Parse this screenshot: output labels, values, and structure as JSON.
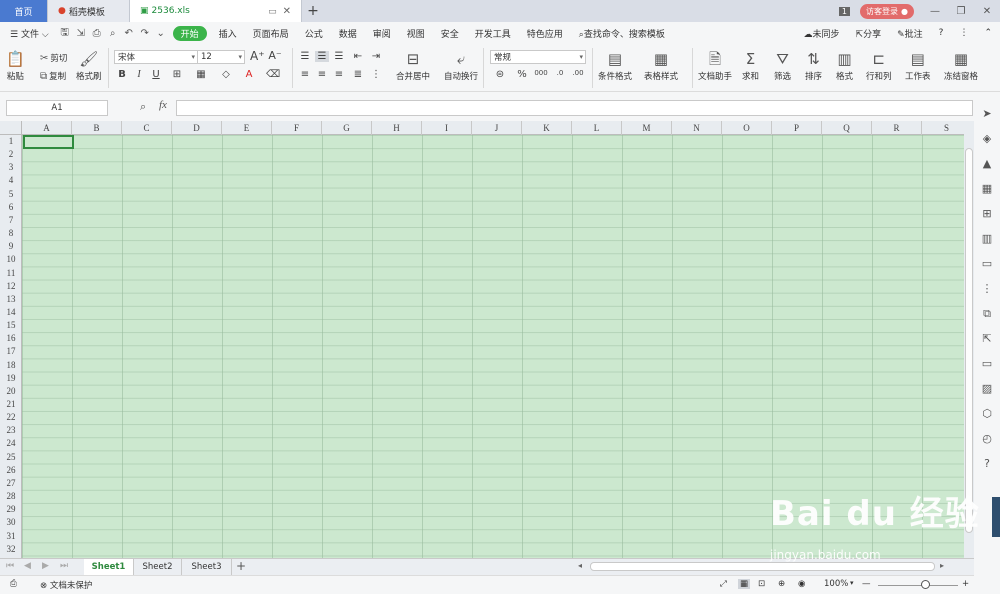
{
  "tabs": {
    "home": "首页",
    "template": "稻壳模板",
    "file": "2536.xls",
    "close": "✕",
    "new_tab": "+"
  },
  "window": {
    "badge": "1",
    "login": "访客登录",
    "minimize": "—",
    "restore": "❐",
    "close": "✕"
  },
  "menu": {
    "file": "文件",
    "items": [
      "开始",
      "插入",
      "页面布局",
      "公式",
      "数据",
      "审阅",
      "视图",
      "安全",
      "开发工具",
      "特色应用"
    ],
    "search": "查找命令、搜索模板",
    "sync": "未同步",
    "share": "分享",
    "comment": "批注",
    "help": "?"
  },
  "ribbon": {
    "paste": "粘贴",
    "cut": "剪切",
    "copy": "复制",
    "format_painter": "格式刷",
    "font_name": "宋体",
    "font_size": "12",
    "bold": "B",
    "italic": "I",
    "underline": "U",
    "font_color_letter": "A",
    "merge": "合并居中",
    "wrap": "自动换行",
    "number_format": "常规",
    "percent": "%",
    "thousands": "000",
    "cond_format": "条件格式",
    "table_style": "表格样式",
    "doc_assist": "文档助手",
    "sum": "求和",
    "filter": "筛选",
    "sort": "排序",
    "format": "格式",
    "rowcol": "行和列",
    "sheet": "工作表",
    "freeze": "冻结窗格"
  },
  "formula_bar": {
    "cell_ref": "A1",
    "fx": "fx",
    "value": ""
  },
  "columns": [
    "A",
    "B",
    "C",
    "D",
    "E",
    "F",
    "G",
    "H",
    "I",
    "J",
    "K",
    "L",
    "M",
    "N",
    "O",
    "P",
    "Q",
    "R",
    "S"
  ],
  "rows": [
    "1",
    "2",
    "3",
    "4",
    "5",
    "6",
    "7",
    "8",
    "9",
    "10",
    "11",
    "12",
    "13",
    "14",
    "15",
    "16",
    "17",
    "18",
    "19",
    "20",
    "21",
    "22",
    "23",
    "24",
    "25",
    "26",
    "27",
    "28",
    "29",
    "30",
    "31",
    "32"
  ],
  "sheets": [
    "Sheet1",
    "Sheet2",
    "Sheet3"
  ],
  "add_sheet": "+",
  "status": {
    "protect": "文档未保护",
    "zoom": "100%",
    "zoom_minus": "—",
    "zoom_plus": "+"
  },
  "watermark": {
    "logo": "Bai du 经验",
    "url": "jingyan.baidu.com"
  },
  "colors": {
    "grid_bg": "#cce8cf",
    "accent": "#3bb44a",
    "tab_blue": "#4a7ad0",
    "login_red": "#e26b6b"
  }
}
